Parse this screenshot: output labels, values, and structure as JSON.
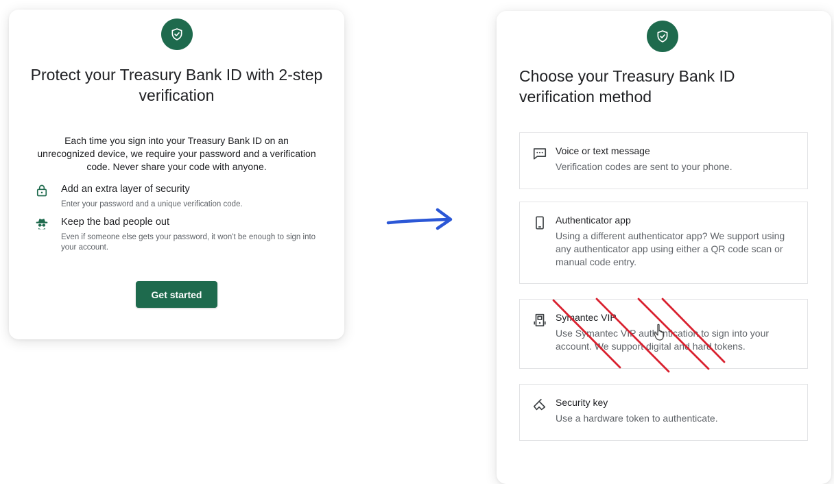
{
  "left": {
    "title": "Protect your Treasury Bank ID with 2-step verification",
    "intro": "Each time you sign into your Treasury Bank ID on an unrecognized device, we require your password and a verification code. Never share your code with anyone.",
    "benefits": [
      {
        "icon": "lock-icon",
        "title": "Add an extra layer of security",
        "desc": "Enter your password and a unique verification code."
      },
      {
        "icon": "spy-icon",
        "title": "Keep the bad people out",
        "desc": "Even if someone else gets your password, it won't be enough to sign into your account."
      }
    ],
    "button_label": "Get started"
  },
  "right": {
    "title": "Choose your Treasury Bank ID verification method",
    "methods": [
      {
        "icon": "message-icon",
        "title": "Voice or text message",
        "desc": "Verification codes are sent to your phone."
      },
      {
        "icon": "phone-icon",
        "title": "Authenticator app",
        "desc": "Using a different authenticator app? We support using any authenticator app using either a QR code scan or manual code entry."
      },
      {
        "icon": "token-icon",
        "title": "Symantec VIP",
        "desc": "Use Symantec VIP authentication to sign into your account. We support digital and hard tokens."
      },
      {
        "icon": "security-key-icon",
        "title": "Security key",
        "desc": "Use a hardware token to authenticate."
      }
    ]
  },
  "colors": {
    "brand_green": "#1e6a4d",
    "arrow_blue": "#2b57d6",
    "strike_red": "#d9212f",
    "text_primary": "#202124",
    "text_secondary": "#5f6368"
  }
}
